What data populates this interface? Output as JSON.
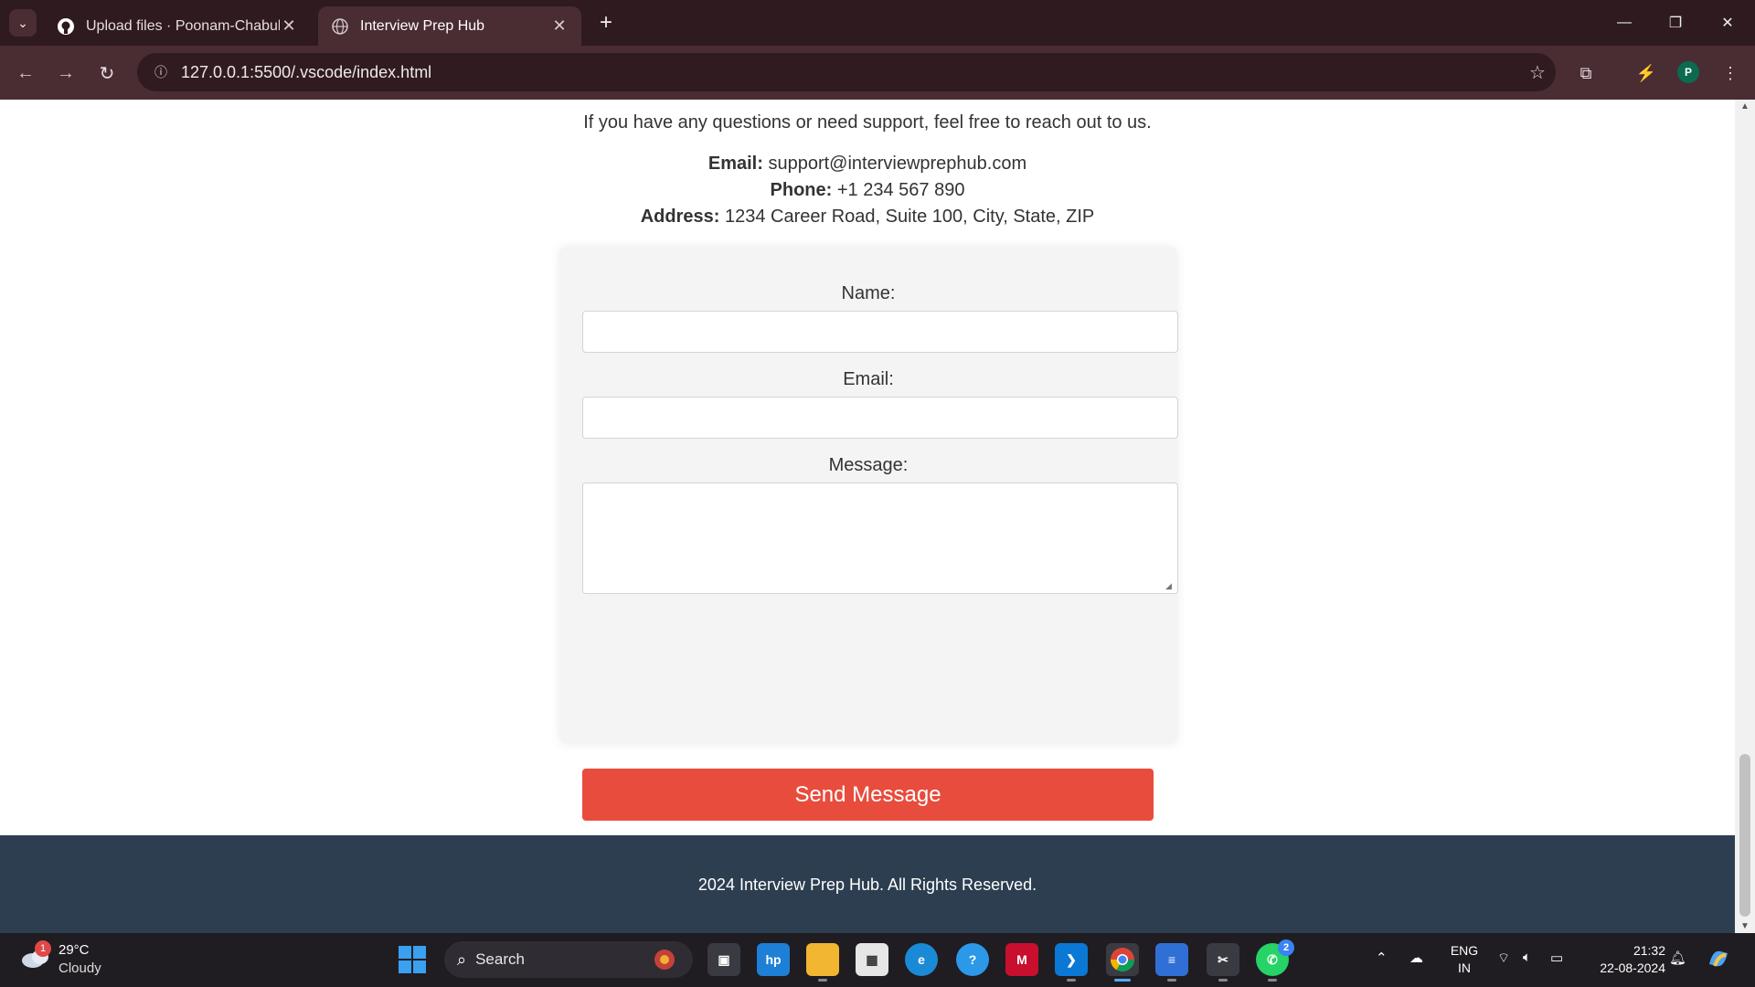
{
  "browser": {
    "tabs": [
      {
        "title": "Upload files · Poonam-Chabuks",
        "active": false,
        "icon": "github-icon"
      },
      {
        "title": "Interview Prep Hub",
        "active": true,
        "icon": "globe-icon"
      }
    ],
    "url": "127.0.0.1:5500/.vscode/index.html",
    "profile_initial": "P"
  },
  "page": {
    "intro": "If you have any questions or need support, feel free to reach out to us.",
    "contact": {
      "email_label": "Email:",
      "email_value": "support@interviewprephub.com",
      "phone_label": "Phone:",
      "phone_value": "+1 234 567 890",
      "address_label": "Address:",
      "address_value": "1234 Career Road, Suite 100, City, State, ZIP"
    },
    "form": {
      "name_label": "Name:",
      "email_label": "Email:",
      "message_label": "Message:",
      "name_value": "",
      "email_value": "",
      "message_value": "",
      "submit_label": "Send Message"
    },
    "footer": "2024 Interview Prep Hub. All Rights Reserved.",
    "colors": {
      "button": "#e84c3d",
      "footer_bg": "#2c3e50",
      "card_bg": "#f4f4f4"
    }
  },
  "taskbar": {
    "weather": {
      "temp": "29°C",
      "desc": "Cloudy",
      "badge": "1"
    },
    "search_label": "Search",
    "whatsapp_badge": "2",
    "language": {
      "line1": "ENG",
      "line2": "IN"
    },
    "time": "21:32",
    "date": "22-08-2024"
  }
}
